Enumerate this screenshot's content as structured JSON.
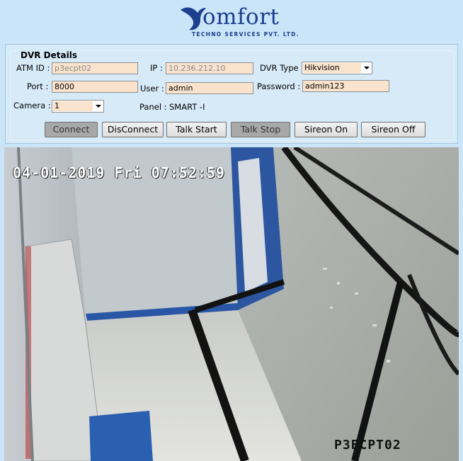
{
  "logo": {
    "word": "omfort",
    "tagline": "TECHNO SERVICES PVT. LTD."
  },
  "dvr": {
    "title": "DVR Details",
    "atm_id_label": "ATM ID :",
    "atm_id_value": "p3ecpt02",
    "ip_label": "IP :",
    "ip_value": "10.236.212.10",
    "dvr_type_label": "DVR Type :",
    "dvr_type_value": "Hikvision",
    "port_label": "Port :",
    "port_value": "8000",
    "user_label": "User :",
    "user_value": "admin",
    "password_label": "Password :",
    "password_value": "admin123",
    "camera_label": "Camera :",
    "camera_value": "1",
    "panel_label": "Panel :",
    "panel_value": "SMART -I"
  },
  "buttons": {
    "connect": "Connect",
    "disconnect": "DisConnect",
    "talk_start": "Talk Start",
    "talk_stop": "Talk Stop",
    "sireon_on": "Sireon On",
    "sireon_off": "Sireon Off"
  },
  "video": {
    "timestamp": "04-01-2019 Fri 07:52:59",
    "camera_name": "P3ECPT02"
  }
}
